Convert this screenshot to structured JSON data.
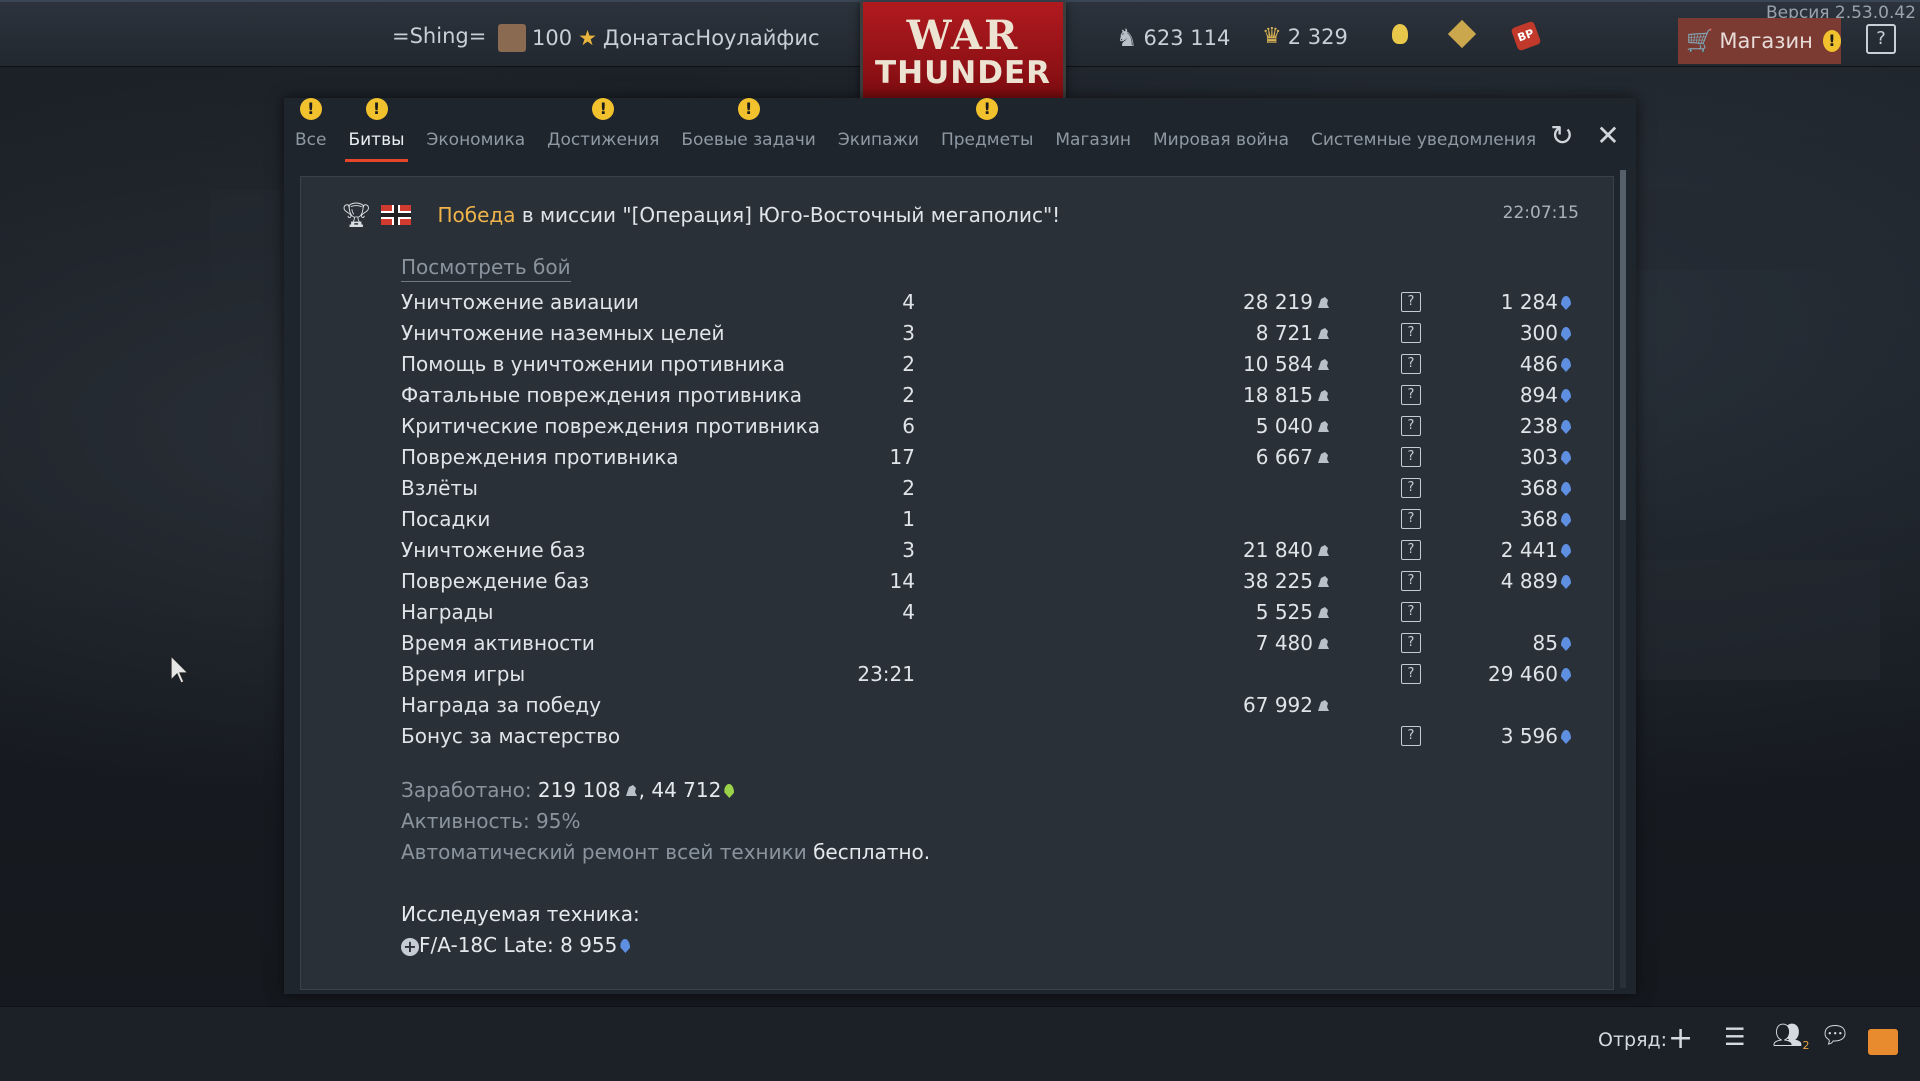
{
  "version": "Версия 2.53.0.42",
  "topbar": {
    "squad_tag": "=Shing=",
    "level": "100",
    "username": "ДонатасНоулайфис",
    "logo_line1": "WAR",
    "logo_line2": "THUNDER",
    "silver_lions": "623 114",
    "golden_eagles": "2 329",
    "shop_label": "Магазин",
    "help": "?"
  },
  "tabs": [
    {
      "label": "Все",
      "warn": true,
      "active": false
    },
    {
      "label": "Битвы",
      "warn": true,
      "active": true
    },
    {
      "label": "Экономика",
      "warn": false,
      "active": false
    },
    {
      "label": "Достижения",
      "warn": true,
      "active": false
    },
    {
      "label": "Боевые задачи",
      "warn": true,
      "active": false
    },
    {
      "label": "Экипажи",
      "warn": false,
      "active": false
    },
    {
      "label": "Предметы",
      "warn": true,
      "active": false
    },
    {
      "label": "Магазин",
      "warn": false,
      "active": false
    },
    {
      "label": "Мировая война",
      "warn": false,
      "active": false
    },
    {
      "label": "Системные уведомления",
      "warn": false,
      "active": false
    }
  ],
  "message": {
    "victory": "Победа",
    "rest": " в миссии \"[Операция] Юго-Восточный мегаполис\"!",
    "time": "22:07:15",
    "watch_battle": "Посмотреть бой"
  },
  "rows": [
    {
      "label": "Уничтожение авиации",
      "count": "4",
      "sl": "28 219",
      "rp": "1 284",
      "help": true
    },
    {
      "label": "Уничтожение наземных целей",
      "count": "3",
      "sl": "8 721",
      "rp": "300",
      "help": true
    },
    {
      "label": "Помощь в уничтожении противника",
      "count": "2",
      "sl": "10 584",
      "rp": "486",
      "help": true
    },
    {
      "label": "Фатальные повреждения противника",
      "count": "2",
      "sl": "18 815",
      "rp": "894",
      "help": true
    },
    {
      "label": "Критические повреждения противника",
      "count": "6",
      "sl": "5 040",
      "rp": "238",
      "help": true
    },
    {
      "label": "Повреждения противника",
      "count": "17",
      "sl": "6 667",
      "rp": "303",
      "help": true
    },
    {
      "label": "Взлёты",
      "count": "2",
      "sl": "",
      "rp": "368",
      "help": true
    },
    {
      "label": "Посадки",
      "count": "1",
      "sl": "",
      "rp": "368",
      "help": true
    },
    {
      "label": "Уничтожение баз",
      "count": "3",
      "sl": "21 840",
      "rp": "2 441",
      "help": true
    },
    {
      "label": "Повреждение баз",
      "count": "14",
      "sl": "38 225",
      "rp": "4 889",
      "help": true
    },
    {
      "label": "Награды",
      "count": "4",
      "sl": "5 525",
      "rp": "",
      "help": true
    },
    {
      "label": "Время активности",
      "count": "",
      "sl": "7 480",
      "rp": "85",
      "help": true
    },
    {
      "label": "Время игры",
      "count": "23:21",
      "sl": "",
      "rp": "29 460",
      "help": true
    },
    {
      "label": "Награда за победу",
      "count": "",
      "sl": "67 992",
      "rp": "",
      "help": false
    },
    {
      "label": "Бонус за мастерство",
      "count": "",
      "sl": "",
      "rp": "3 596",
      "help": true
    }
  ],
  "summary": {
    "earned_label": "Заработано: ",
    "earned_sl": "219 108",
    "earned_sep": ", ",
    "earned_rp": "44 712",
    "activity_label": "Активность: ",
    "activity_value": "95%",
    "repair_text": "Автоматический ремонт всей техники ",
    "repair_value": "бесплатно.",
    "research_label": "Исследуемая техника:",
    "research_vehicle": "F/A-18C Late: ",
    "research_rp": "8 955"
  },
  "bottombar": {
    "squad_label": "Отряд:",
    "friends_count": "2"
  },
  "colors": {
    "accent_red": "#e7452a",
    "victory": "#f0b44a",
    "warn": "#f2c12e",
    "rp_blue": "#5f8fe0"
  }
}
